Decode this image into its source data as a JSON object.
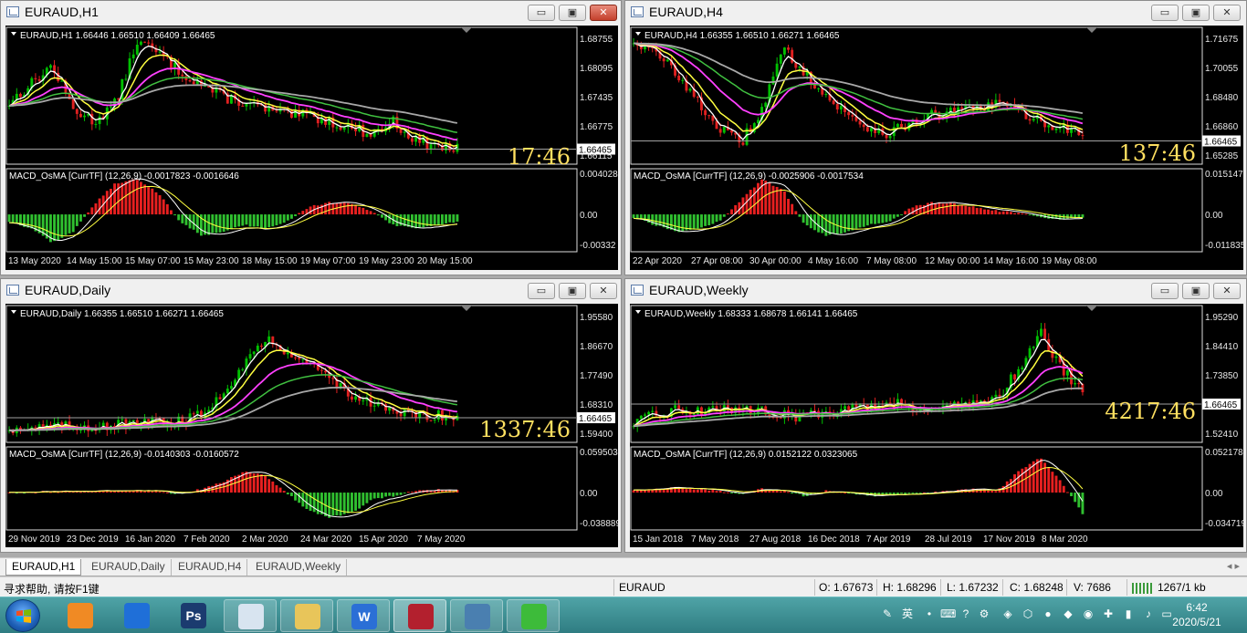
{
  "windows": [
    {
      "id": "h1",
      "title": "EURAUD,H1",
      "ohlc_text": "EURAUD,H1  1.66446 1.66510 1.66409 1.66465",
      "price_labels": [
        "1.68755",
        "1.68095",
        "1.67435",
        "1.66775",
        "1.66115"
      ],
      "current_price": "1.66465",
      "countdown": "17:46",
      "macd_text": "MACD_OsMA [CurrTF] (12,26,9) -0.0017823 -0.0016646",
      "macd_labels": [
        "0.004028",
        "0.00",
        "-0.00332"
      ],
      "dates": [
        "13 May 2020",
        "14 May 15:00",
        "15 May 07:00",
        "15 May 23:00",
        "18 May 15:00",
        "19 May 07:00",
        "19 May 23:00",
        "20 May 15:00"
      ],
      "close_active": true
    },
    {
      "id": "h4",
      "title": "EURAUD,H4",
      "ohlc_text": "EURAUD,H4  1.66355 1.66510 1.66271 1.66465",
      "price_labels": [
        "1.71675",
        "1.70055",
        "1.68480",
        "1.66860",
        "1.65285"
      ],
      "current_price": "1.66465",
      "countdown": "137:46",
      "macd_text": "MACD_OsMA [CurrTF] (12,26,9) -0.0025906 -0.0017534",
      "macd_labels": [
        "0.0151478",
        "0.00",
        "-0.011835"
      ],
      "dates": [
        "22 Apr 2020",
        "27 Apr 08:00",
        "30 Apr 00:00",
        "4 May 16:00",
        "7 May 08:00",
        "12 May 00:00",
        "14 May 16:00",
        "19 May 08:00"
      ],
      "close_active": false
    },
    {
      "id": "d1",
      "title": "EURAUD,Daily",
      "ohlc_text": "EURAUD,Daily  1.66355 1.66510 1.66271 1.66465",
      "price_labels": [
        "1.95580",
        "1.86670",
        "1.77490",
        "1.68310",
        "1.59400"
      ],
      "current_price": "1.66465",
      "countdown": "1337:46",
      "macd_text": "MACD_OsMA [CurrTF] (12,26,9) -0.0140303 -0.0160572",
      "macd_labels": [
        "0.0595038",
        "0.00",
        "-0.038889"
      ],
      "dates": [
        "29 Nov 2019",
        "23 Dec 2019",
        "16 Jan 2020",
        "7 Feb 2020",
        "2 Mar 2020",
        "24 Mar 2020",
        "15 Apr 2020",
        "7 May 2020"
      ],
      "close_active": false
    },
    {
      "id": "w1",
      "title": "EURAUD,Weekly",
      "ohlc_text": "EURAUD,Weekly  1.68333 1.68678 1.66141 1.66465",
      "price_labels": [
        "1.95290",
        "1.84410",
        "1.73850",
        "1.62970",
        "1.52410"
      ],
      "current_price": "1.66465",
      "countdown": "4217:46",
      "macd_text": "MACD_OsMA [CurrTF] (12,26,9) 0.0152122 0.0323065",
      "macd_labels": [
        "0.0521785",
        "0.00",
        "-0.034719"
      ],
      "dates": [
        "15 Jan 2018",
        "7 May 2018",
        "27 Aug 2018",
        "16 Dec 2018",
        "7 Apr 2019",
        "28 Jul 2019",
        "17 Nov 2019",
        "8 Mar 2020"
      ],
      "close_active": false
    }
  ],
  "window_buttons": {
    "minimize": "▭",
    "restore": "▣",
    "close": "✕"
  },
  "tabs": [
    "EURAUD,H1",
    "EURAUD,Daily",
    "EURAUD,H4",
    "EURAUD,Weekly"
  ],
  "tab_arrows": "◂  ▸",
  "statusbar": {
    "help": "寻求帮助, 请按F1键",
    "symbol": "EURAUD",
    "open": "O: 1.67673",
    "high": "H: 1.68296",
    "low": "L: 1.67232",
    "close": "C: 1.68248",
    "volume": "V: 7686",
    "traffic": "1267/1 kb"
  },
  "taskbar": {
    "apps": [
      {
        "name": "browser-app",
        "label": "",
        "color": "#f08a24"
      },
      {
        "name": "feishu-app",
        "label": "",
        "color": "#1f6fd8"
      },
      {
        "name": "photoshop-app",
        "label": "Ps",
        "color": "#1b3b6f"
      },
      {
        "name": "paint-app",
        "label": "",
        "color": "#d8e4f0"
      },
      {
        "name": "explorer-app",
        "label": "",
        "color": "#e8c55a"
      },
      {
        "name": "wps-app",
        "label": "W",
        "color": "#2b6fd6"
      },
      {
        "name": "metatrader-app",
        "label": "",
        "color": "#b3202e"
      },
      {
        "name": "image-viewer-app",
        "label": "",
        "color": "#4a7fb0"
      },
      {
        "name": "wechat-app",
        "label": "",
        "color": "#3dbb3a"
      }
    ],
    "ime": "英",
    "time": "6:42",
    "date": "2020/5/21"
  },
  "colors": {
    "bull": "#00c000",
    "bear": "#e02020",
    "ma_fast": "#ffffff",
    "ma_mid": "#ffff40",
    "ma_magenta": "#ff40ff",
    "ma_green": "#40c040",
    "ma_gray": "#a8a8a8",
    "countdown": "#ffe060"
  }
}
